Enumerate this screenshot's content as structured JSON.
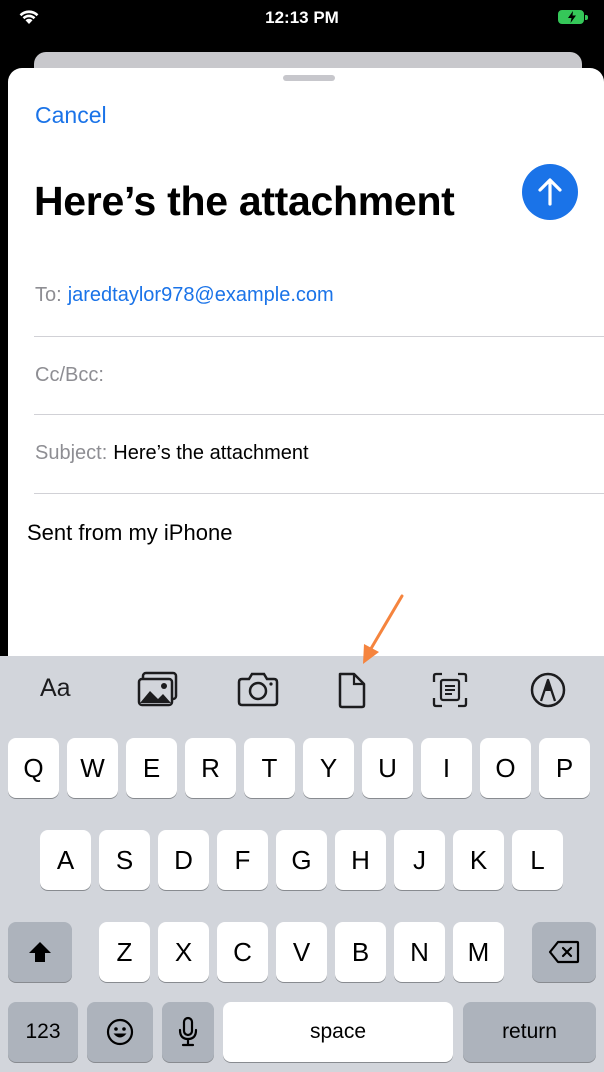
{
  "status_bar": {
    "time": "12:13 PM"
  },
  "compose": {
    "cancel_label": "Cancel",
    "title": "Here’s the attachment",
    "to_label": "To:",
    "to_value": "jaredtaylor978@example.com",
    "cc_label": "Cc/Bcc:",
    "subject_label": "Subject:",
    "subject_value": "Here’s the attachment",
    "body": "Sent from my iPhone"
  },
  "keyboard_toolbar": {
    "format_label": "Aa",
    "icons": [
      "photo-library-icon",
      "camera-icon",
      "document-icon",
      "scan-document-icon",
      "markup-icon"
    ]
  },
  "keyboard": {
    "row1": [
      "Q",
      "W",
      "E",
      "R",
      "T",
      "Y",
      "U",
      "I",
      "O",
      "P"
    ],
    "row2": [
      "A",
      "S",
      "D",
      "F",
      "G",
      "H",
      "J",
      "K",
      "L"
    ],
    "row3": [
      "Z",
      "X",
      "C",
      "V",
      "B",
      "N",
      "M"
    ],
    "numbers_label": "123",
    "space_label": "space",
    "return_label": "return"
  },
  "colors": {
    "accent": "#1a73e8",
    "annotation": "#f5843e",
    "battery": "#35c759"
  }
}
